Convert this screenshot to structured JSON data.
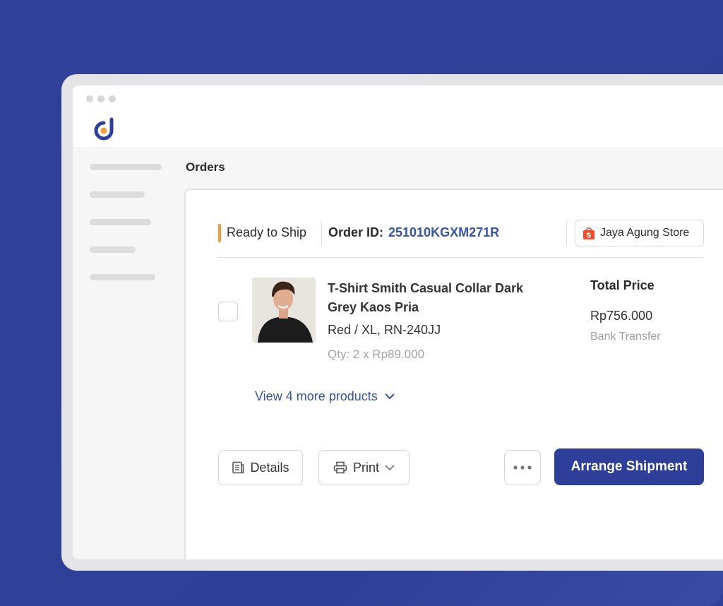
{
  "page": {
    "title": "Orders"
  },
  "order": {
    "status": "Ready to Ship",
    "id_label": "Order ID:",
    "id": "251010KGXM271R",
    "store": "Jaya Agung Store"
  },
  "product": {
    "name": "T-Shirt Smith Casual Collar Dark Grey Kaos Pria",
    "variant": "Red / XL, RN-240JJ",
    "quantity": "Qty: 2 x Rp89.000"
  },
  "pricing": {
    "label": "Total Price",
    "value": "Rp756.000",
    "payment_method": "Bank Transfer"
  },
  "more_products": "View 4 more products",
  "actions": {
    "details": "Details",
    "print": "Print",
    "arrange_shipment": "Arrange Shipment"
  },
  "icons": {
    "logo": "app-logo-icon",
    "store": "shopee-bag-icon",
    "details": "document-icon",
    "print": "printer-icon",
    "chevron": "chevron-down-icon",
    "more": "ellipsis-icon"
  },
  "colors": {
    "background": "#2f409a",
    "accent": "#3653a6",
    "primary_button": "#2d3f98",
    "status": "#f59b3a",
    "store_icon": "#ee4d2d"
  }
}
